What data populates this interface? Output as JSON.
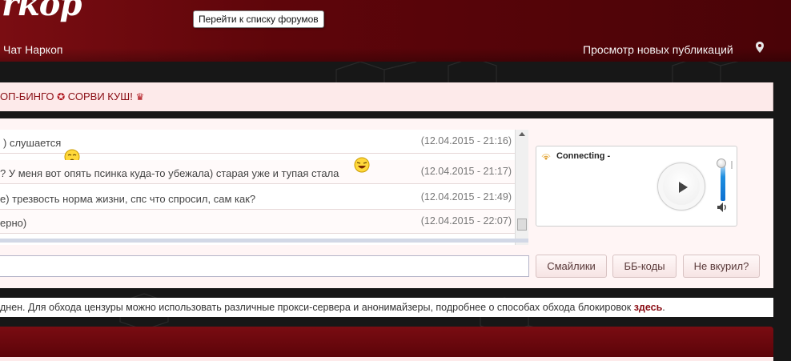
{
  "header": {
    "logo_text": "rkop",
    "tooltip": "Перейти к списку форумов",
    "nav_chat": "Чат Наркоп",
    "nav_new_publications": "Просмотр новых публикаций"
  },
  "marquee": {
    "text_left": "ОП-БИНГО",
    "separator_glyph": "✪",
    "text_right": "СОРВИ КУШ!",
    "crown_glyph": "♛"
  },
  "chat": {
    "messages": [
      {
        "text": ") слушается",
        "time": "(12.04.2015 - 21:16)",
        "smiley": "sleepy-smiley-icon"
      },
      {
        "text": "? У меня вот опять псинка куда-то убежала) старая уже и тупая стала",
        "time": "(12.04.2015 - 21:17)",
        "smiley": "laughing-smiley-icon"
      },
      {
        "text": "е) трезвость норма жизни, спс что спросил, сам как?",
        "time": "(12.04.2015 - 21:49)",
        "smiley": ""
      },
      {
        "text": "ерно)",
        "time": "(12.04.2015 - 22:07)",
        "smiley": ""
      }
    ],
    "input_value": "",
    "buttons": {
      "smileys": "Смайлики",
      "bbcodes": "ББ-коды",
      "help": "Не вкурил?"
    }
  },
  "radio": {
    "status": "Connecting -"
  },
  "notice": {
    "text": "днен. Для обхода цензуры можно использовать различные прокси-сервера и анонимайзеры, подробнее о способах обхода блокировок ",
    "link": "здесь",
    "trailing": "."
  },
  "colors": {
    "brand_red": "#7a0d12",
    "accent_link": "#8a0d14",
    "volume_blue": "#1e8fe0"
  }
}
